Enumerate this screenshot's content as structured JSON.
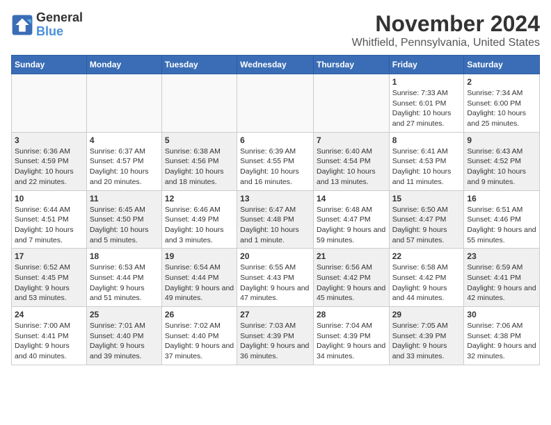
{
  "logo": {
    "line1": "General",
    "line2": "Blue"
  },
  "title": "November 2024",
  "location": "Whitfield, Pennsylvania, United States",
  "days_of_week": [
    "Sunday",
    "Monday",
    "Tuesday",
    "Wednesday",
    "Thursday",
    "Friday",
    "Saturday"
  ],
  "weeks": [
    [
      {
        "day": "",
        "info": "",
        "shaded": true
      },
      {
        "day": "",
        "info": "",
        "shaded": true
      },
      {
        "day": "",
        "info": "",
        "shaded": true
      },
      {
        "day": "",
        "info": "",
        "shaded": true
      },
      {
        "day": "",
        "info": "",
        "shaded": true
      },
      {
        "day": "1",
        "info": "Sunrise: 7:33 AM\nSunset: 6:01 PM\nDaylight: 10 hours and 27 minutes.",
        "shaded": false
      },
      {
        "day": "2",
        "info": "Sunrise: 7:34 AM\nSunset: 6:00 PM\nDaylight: 10 hours and 25 minutes.",
        "shaded": false
      }
    ],
    [
      {
        "day": "3",
        "info": "Sunrise: 6:36 AM\nSunset: 4:59 PM\nDaylight: 10 hours and 22 minutes.",
        "shaded": true
      },
      {
        "day": "4",
        "info": "Sunrise: 6:37 AM\nSunset: 4:57 PM\nDaylight: 10 hours and 20 minutes.",
        "shaded": false
      },
      {
        "day": "5",
        "info": "Sunrise: 6:38 AM\nSunset: 4:56 PM\nDaylight: 10 hours and 18 minutes.",
        "shaded": true
      },
      {
        "day": "6",
        "info": "Sunrise: 6:39 AM\nSunset: 4:55 PM\nDaylight: 10 hours and 16 minutes.",
        "shaded": false
      },
      {
        "day": "7",
        "info": "Sunrise: 6:40 AM\nSunset: 4:54 PM\nDaylight: 10 hours and 13 minutes.",
        "shaded": true
      },
      {
        "day": "8",
        "info": "Sunrise: 6:41 AM\nSunset: 4:53 PM\nDaylight: 10 hours and 11 minutes.",
        "shaded": false
      },
      {
        "day": "9",
        "info": "Sunrise: 6:43 AM\nSunset: 4:52 PM\nDaylight: 10 hours and 9 minutes.",
        "shaded": true
      }
    ],
    [
      {
        "day": "10",
        "info": "Sunrise: 6:44 AM\nSunset: 4:51 PM\nDaylight: 10 hours and 7 minutes.",
        "shaded": false
      },
      {
        "day": "11",
        "info": "Sunrise: 6:45 AM\nSunset: 4:50 PM\nDaylight: 10 hours and 5 minutes.",
        "shaded": true
      },
      {
        "day": "12",
        "info": "Sunrise: 6:46 AM\nSunset: 4:49 PM\nDaylight: 10 hours and 3 minutes.",
        "shaded": false
      },
      {
        "day": "13",
        "info": "Sunrise: 6:47 AM\nSunset: 4:48 PM\nDaylight: 10 hours and 1 minute.",
        "shaded": true
      },
      {
        "day": "14",
        "info": "Sunrise: 6:48 AM\nSunset: 4:47 PM\nDaylight: 9 hours and 59 minutes.",
        "shaded": false
      },
      {
        "day": "15",
        "info": "Sunrise: 6:50 AM\nSunset: 4:47 PM\nDaylight: 9 hours and 57 minutes.",
        "shaded": true
      },
      {
        "day": "16",
        "info": "Sunrise: 6:51 AM\nSunset: 4:46 PM\nDaylight: 9 hours and 55 minutes.",
        "shaded": false
      }
    ],
    [
      {
        "day": "17",
        "info": "Sunrise: 6:52 AM\nSunset: 4:45 PM\nDaylight: 9 hours and 53 minutes.",
        "shaded": true
      },
      {
        "day": "18",
        "info": "Sunrise: 6:53 AM\nSunset: 4:44 PM\nDaylight: 9 hours and 51 minutes.",
        "shaded": false
      },
      {
        "day": "19",
        "info": "Sunrise: 6:54 AM\nSunset: 4:44 PM\nDaylight: 9 hours and 49 minutes.",
        "shaded": true
      },
      {
        "day": "20",
        "info": "Sunrise: 6:55 AM\nSunset: 4:43 PM\nDaylight: 9 hours and 47 minutes.",
        "shaded": false
      },
      {
        "day": "21",
        "info": "Sunrise: 6:56 AM\nSunset: 4:42 PM\nDaylight: 9 hours and 45 minutes.",
        "shaded": true
      },
      {
        "day": "22",
        "info": "Sunrise: 6:58 AM\nSunset: 4:42 PM\nDaylight: 9 hours and 44 minutes.",
        "shaded": false
      },
      {
        "day": "23",
        "info": "Sunrise: 6:59 AM\nSunset: 4:41 PM\nDaylight: 9 hours and 42 minutes.",
        "shaded": true
      }
    ],
    [
      {
        "day": "24",
        "info": "Sunrise: 7:00 AM\nSunset: 4:41 PM\nDaylight: 9 hours and 40 minutes.",
        "shaded": false
      },
      {
        "day": "25",
        "info": "Sunrise: 7:01 AM\nSunset: 4:40 PM\nDaylight: 9 hours and 39 minutes.",
        "shaded": true
      },
      {
        "day": "26",
        "info": "Sunrise: 7:02 AM\nSunset: 4:40 PM\nDaylight: 9 hours and 37 minutes.",
        "shaded": false
      },
      {
        "day": "27",
        "info": "Sunrise: 7:03 AM\nSunset: 4:39 PM\nDaylight: 9 hours and 36 minutes.",
        "shaded": true
      },
      {
        "day": "28",
        "info": "Sunrise: 7:04 AM\nSunset: 4:39 PM\nDaylight: 9 hours and 34 minutes.",
        "shaded": false
      },
      {
        "day": "29",
        "info": "Sunrise: 7:05 AM\nSunset: 4:39 PM\nDaylight: 9 hours and 33 minutes.",
        "shaded": true
      },
      {
        "day": "30",
        "info": "Sunrise: 7:06 AM\nSunset: 4:38 PM\nDaylight: 9 hours and 32 minutes.",
        "shaded": false
      }
    ]
  ]
}
